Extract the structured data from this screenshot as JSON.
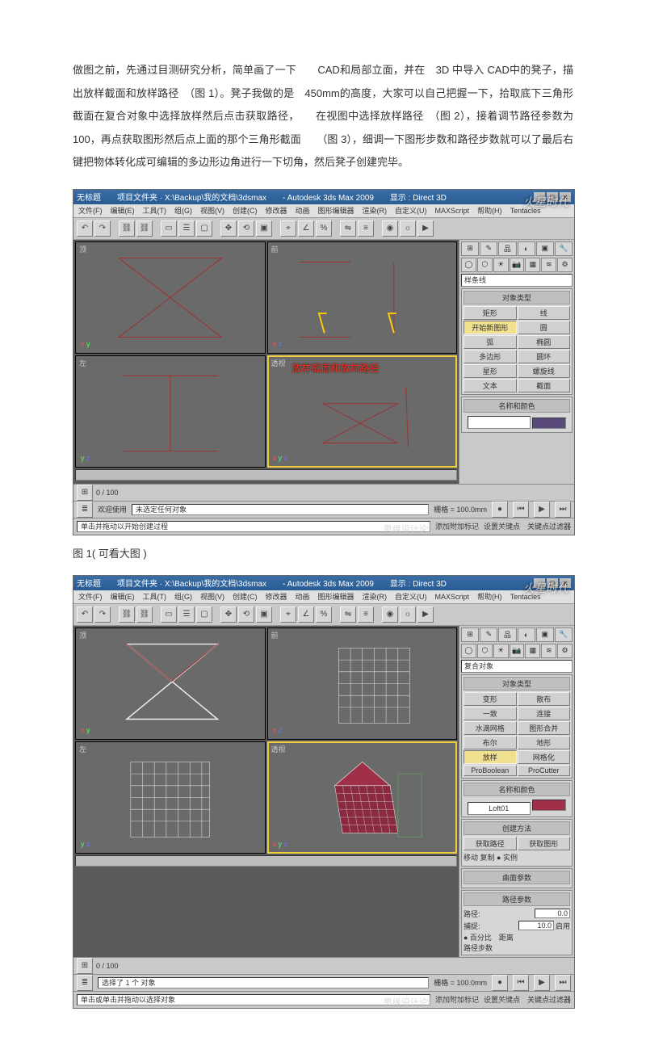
{
  "body_text": "做图之前，先通过目测研究分析，简单画了一下　　CAD和局部立面，并在　3D 中导入 CAD中的凳子，描出放样截面和放样路径　（图 1）。凳子我做的是　450mm的高度，大家可以自己把握一下，拾取底下三角形截面在复合对象中选择放样然后点击获取路径，　　在视图中选择放样路径　（图 2），接着调节路径参数为　100，再点获取图形然后点上面的那个三角形截面　　（图 3），细调一下图形步数和路径步数就可以了最后右键把物体转化成可编辑的多边形边角进行一下切角，然后凳子创建完毕。",
  "caption1": "图 1( 可看大图 )",
  "win1": {
    "title": "无标题　　项目文件夹 · X:\\Backup\\我的文档\\3dsmax　　- Autodesk 3ds Max 2009　　显示 : Direct 3D",
    "menu": [
      "文件(F)",
      "编辑(E)",
      "工具(T)",
      "组(G)",
      "视图(V)",
      "创建(C)",
      "修改器",
      "动画",
      "图形编辑器",
      "渲染(R)",
      "自定义(U)",
      "MAXScript",
      "帮助(H)",
      "Tentacles"
    ],
    "side_dropdown": "样条线",
    "group1_title": "对象类型",
    "buttons1": [
      "矩形",
      "线",
      "开始新图形",
      "圆",
      "弧",
      "椭圆",
      "多边形",
      "圆环",
      "星形",
      "螺旋线",
      "文本",
      "截面"
    ],
    "selected_button": "开始新图形",
    "group2_title": "名称和颜色",
    "annot_text": "放样截面和放样路径",
    "status_left": "未选定任何对象",
    "status_hint": "单击并拖动以开始创建过程",
    "bottom_left": "欢迎使用",
    "frame": "0 / 100",
    "grid": "栅格 = 100.0mm",
    "snap_label": "添加附加标记",
    "lock_area": "设置关键点　关键点过滤器",
    "watermark": "火星时代",
    "bottom_water": "思缘设计论坛 MISSYUAN.COM"
  },
  "win2": {
    "title": "无标题　　项目文件夹 · X:\\Backup\\我的文档\\3dsmax　　- Autodesk 3ds Max 2009　　显示 : Direct 3D",
    "menu": [
      "文件(F)",
      "编辑(E)",
      "工具(T)",
      "组(G)",
      "视图(V)",
      "创建(C)",
      "修改器",
      "动画",
      "图形编辑器",
      "渲染(R)",
      "自定义(U)",
      "MAXScript",
      "帮助(H)",
      "Tentacles"
    ],
    "side_dropdown": "复合对象",
    "group1_title": "对象类型",
    "buttons1": [
      "变形",
      "散布",
      "一致",
      "连接",
      "水滴网格",
      "图形合并",
      "布尔",
      "地形",
      "放样",
      "网格化",
      "ProBoolean",
      "ProCutter"
    ],
    "selected_button": "放样",
    "group2_title": "名称和颜色",
    "name_field": "Loft01",
    "group3_title": "创建方法",
    "method_btns": [
      "获取路径",
      "获取图形"
    ],
    "method_radios": "移动 复制 ● 实例",
    "group4_title": "曲面参数",
    "group5_title": "路径参数",
    "path_label": "路径:",
    "path_val": "0.0",
    "snap_label_p": "捕捉:",
    "snap_val": "10.0",
    "on_label": "启用",
    "dist_labels": "● 百分比　距离",
    "path_step_label": "路径步数",
    "status_left": "选择了 1 个 对象",
    "status_hint": "单击或单击并拖动以选择对象",
    "frame": "0 / 100",
    "grid": "栅格 = 100.0mm",
    "snap_label2": "添加附加标记",
    "lock_area": "设置关键点　关键点过滤器",
    "watermark": "火星时代",
    "bottom_water": "思缘设计论坛 MISSYUAN.COM"
  }
}
